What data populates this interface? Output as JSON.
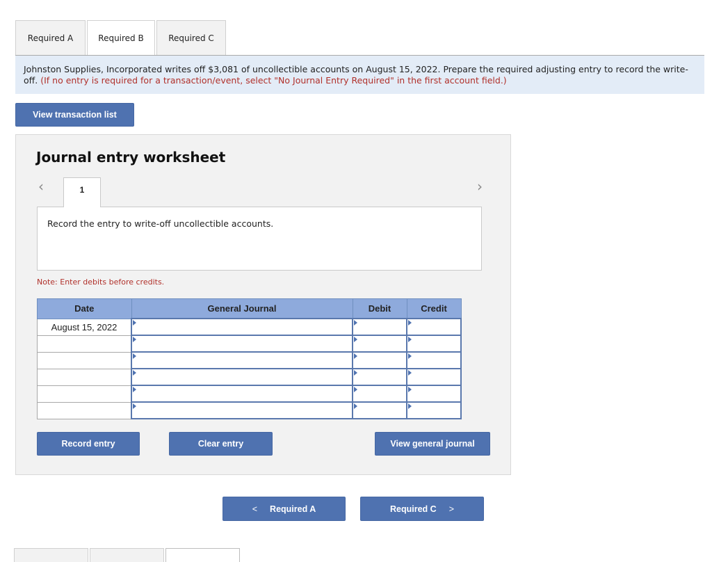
{
  "tabs": [
    {
      "label": "Required A",
      "active": false
    },
    {
      "label": "Required B",
      "active": true
    },
    {
      "label": "Required C",
      "active": false
    }
  ],
  "prompt": {
    "text": "Johnston Supplies, Incorporated writes off $3,081 of uncollectible accounts on August 15, 2022. Prepare the required adjusting entry to record the write-off.",
    "instruction": "(If no entry is required for a transaction/event, select \"No Journal Entry Required\" in the first account field.)"
  },
  "view_transaction_list": "View transaction list",
  "worksheet": {
    "title": "Journal entry worksheet",
    "entry_number": "1",
    "prev_icon": "chevron-left",
    "next_icon": "chevron-right",
    "description": "Record the entry to write-off uncollectible accounts.",
    "note": "Note: Enter debits before credits.",
    "table": {
      "headers": [
        "Date",
        "General Journal",
        "Debit",
        "Credit"
      ],
      "rows": [
        {
          "date": "August 15, 2022",
          "account": "",
          "debit": "",
          "credit": ""
        },
        {
          "date": "",
          "account": "",
          "debit": "",
          "credit": ""
        },
        {
          "date": "",
          "account": "",
          "debit": "",
          "credit": ""
        },
        {
          "date": "",
          "account": "",
          "debit": "",
          "credit": ""
        },
        {
          "date": "",
          "account": "",
          "debit": "",
          "credit": ""
        },
        {
          "date": "",
          "account": "",
          "debit": "",
          "credit": ""
        }
      ]
    },
    "buttons": {
      "record": "Record entry",
      "clear": "Clear entry",
      "view_journal": "View general journal"
    }
  },
  "nav": {
    "prev_label": "Required A",
    "next_label": "Required C",
    "prev_icon": "<",
    "next_icon": ">"
  },
  "colors": {
    "button": "#4f72b0",
    "header": "#8eaadc",
    "prompt_bg": "#e3ecf7",
    "instruction_red": "#b0302a"
  }
}
